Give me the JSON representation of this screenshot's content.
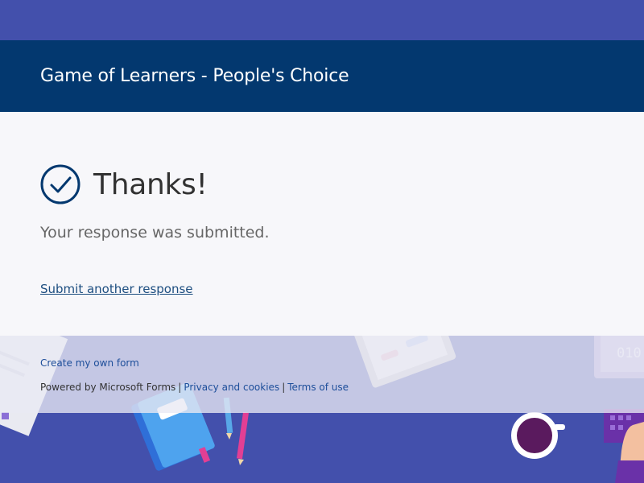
{
  "header": {
    "form_title": "Game of Learners - People's Choice"
  },
  "confirmation": {
    "heading": "Thanks!",
    "message": "Your response was submitted.",
    "submit_another_label": "Submit another response",
    "check_icon": "checkmark-circle-icon"
  },
  "footer": {
    "create_form_label": "Create my own form",
    "powered_by": "Powered by Microsoft Forms",
    "privacy_label": "Privacy and cookies",
    "terms_label": "Terms of use",
    "separator": "|"
  },
  "background": {
    "binary_text": "010",
    "colors": {
      "primary_bg": "#4350ac",
      "header": "#03386f",
      "card": "#f7f7fa",
      "link": "#1d4e80"
    }
  }
}
